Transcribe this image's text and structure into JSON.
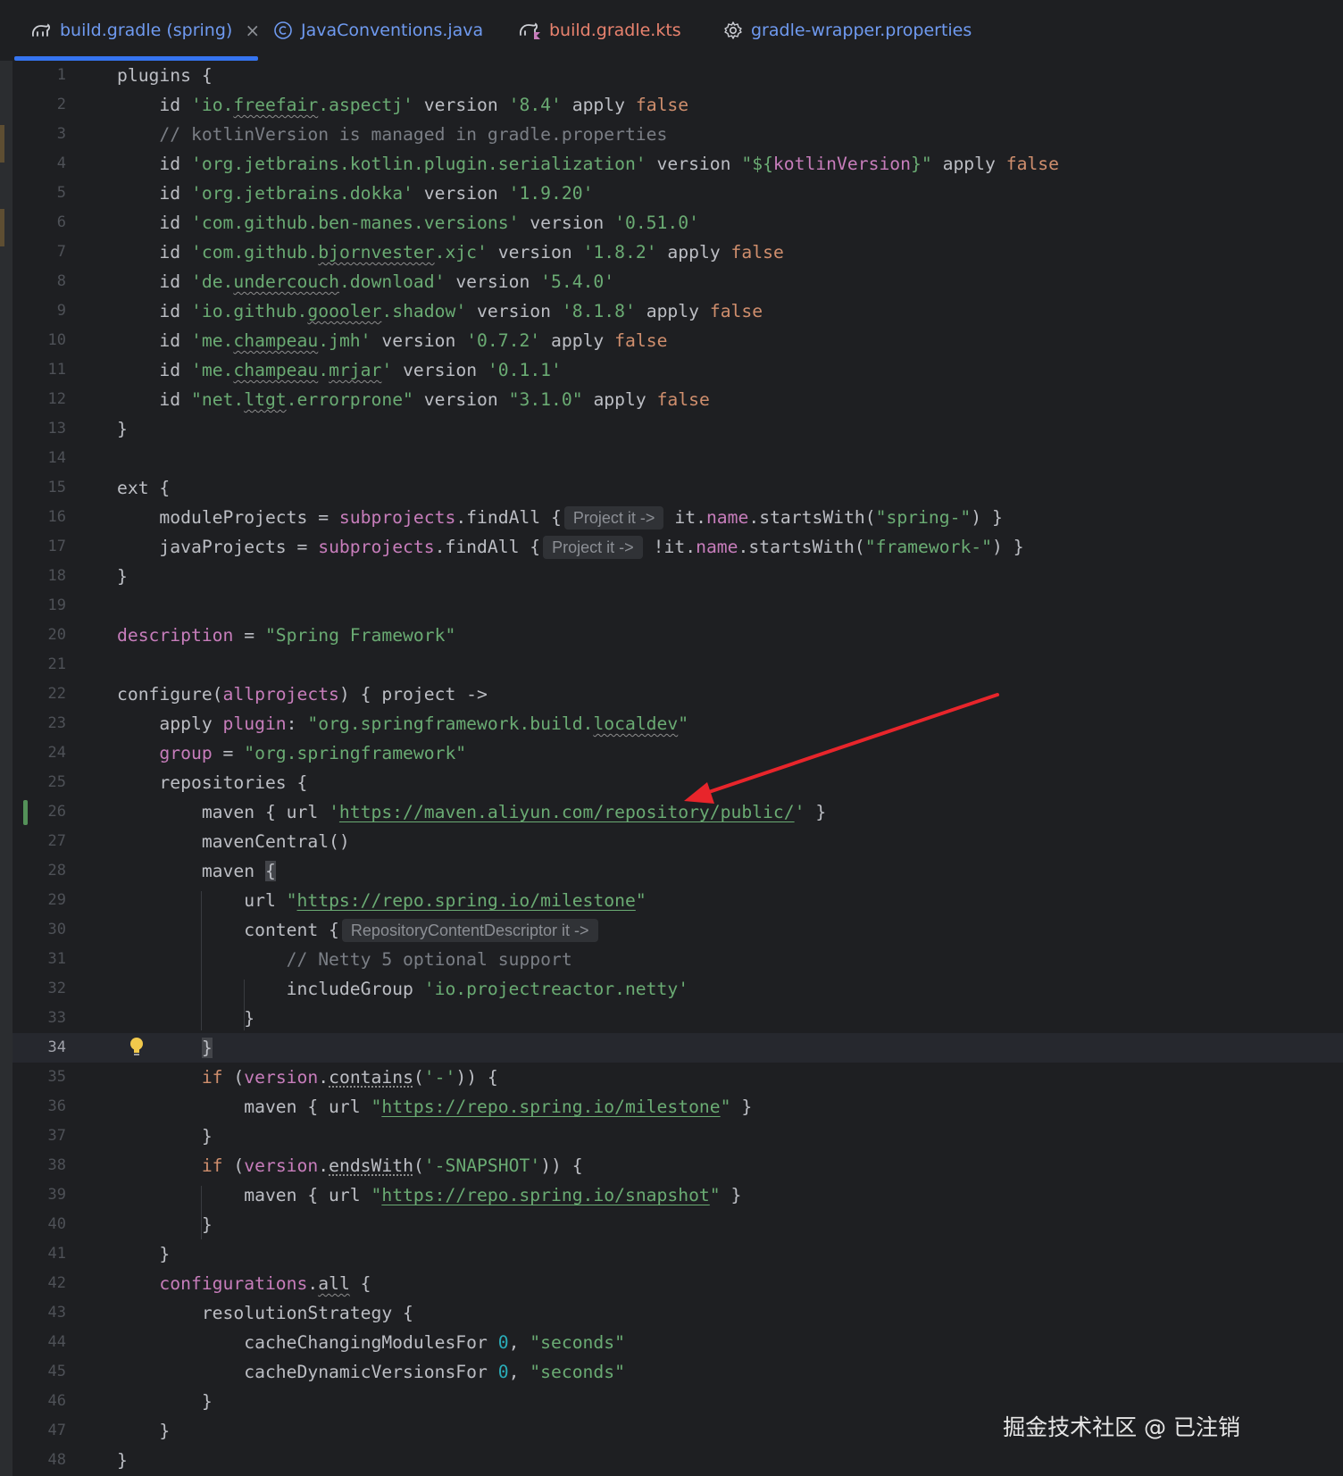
{
  "tabs": [
    {
      "label": "build.gradle (spring)",
      "close": "×",
      "icon": "gradle-elephant-icon",
      "color": "#6f9af0"
    },
    {
      "label": "JavaConventions.java",
      "icon": "java-class-icon",
      "color": "#6f9af0"
    },
    {
      "label": "build.gradle.kts",
      "icon": "gradle-kotlin-icon",
      "color": "#e8826e"
    },
    {
      "label": "gradle-wrapper.properties",
      "icon": "gear-icon",
      "color": "#6f9af0"
    }
  ],
  "editor": {
    "current_line": 34,
    "line_numbers": [
      "1",
      "2",
      "3",
      "4",
      "5",
      "6",
      "7",
      "8",
      "9",
      "10",
      "11",
      "12",
      "13",
      "14",
      "15",
      "16",
      "17",
      "18",
      "19",
      "20",
      "21",
      "22",
      "23",
      "24",
      "25",
      "26",
      "27",
      "28",
      "29",
      "30",
      "31",
      "32",
      "33",
      "34",
      "35",
      "36",
      "37",
      "38",
      "39",
      "40",
      "41",
      "42",
      "43",
      "44",
      "45",
      "46",
      "47",
      "48"
    ],
    "inlay_hints": {
      "h16": "Project it ->",
      "h17": "Project it ->",
      "h30": "RepositoryContentDescriptor it ->"
    },
    "t": {
      "l1a": "plugins {",
      "l2a": "    id ",
      "l2b": "'io.",
      "l2c": "freefair",
      "l2d": ".aspectj'",
      "l2e": " version ",
      "l2f": "'8.4'",
      "l2g": " apply ",
      "l2h": "false",
      "l3a": "    // kotlinVersion is managed in gradle.properties",
      "l4a": "    id ",
      "l4b": "'org.jetbrains.kotlin.plugin.serialization'",
      "l4c": " version ",
      "l4d": "\"${",
      "l4e": "kotlinVersion",
      "l4f": "}\"",
      "l4g": " apply ",
      "l4h": "false",
      "l5a": "    id ",
      "l5b": "'org.jetbrains.dokka'",
      "l5c": " version ",
      "l5d": "'1.9.20'",
      "l6a": "    id ",
      "l6b": "'com.github.ben-manes.versions'",
      "l6c": " version ",
      "l6d": "'0.51.0'",
      "l7a": "    id ",
      "l7b": "'com.github.",
      "l7c": "bjornvester",
      "l7d": ".xjc'",
      "l7e": " version ",
      "l7f": "'1.8.2'",
      "l7g": " apply ",
      "l7h": "false",
      "l8a": "    id ",
      "l8b": "'de.",
      "l8c": "undercouch",
      "l8d": ".download'",
      "l8e": " version ",
      "l8f": "'5.4.0'",
      "l9a": "    id ",
      "l9b": "'io.github.",
      "l9c": "goooler",
      "l9d": ".shadow'",
      "l9e": " version ",
      "l9f": "'8.1.8'",
      "l9g": " apply ",
      "l9h": "false",
      "l10a": "    id ",
      "l10b": "'me.",
      "l10c": "champeau",
      "l10d": ".jmh'",
      "l10e": " version ",
      "l10f": "'0.7.2'",
      "l10g": " apply ",
      "l10h": "false",
      "l11a": "    id ",
      "l11b": "'me.",
      "l11c": "champeau",
      "l11d": ".",
      "l11e": "mrjar",
      "l11f": "'",
      "l11g": " version ",
      "l11h": "'0.1.1'",
      "l12a": "    id ",
      "l12b": "\"net.",
      "l12c": "ltgt",
      "l12d": ".errorprone\"",
      "l12e": " version ",
      "l12f": "\"3.1.0\"",
      "l12g": " apply ",
      "l12h": "false",
      "l13a": "}",
      "l15a": "ext {",
      "l16a": "    moduleProjects = ",
      "l16b": "subprojects",
      "l16c": ".findAll {",
      "l16d": "it.",
      "l16e": "name",
      "l16f": ".startsWith(",
      "l16g": "\"spring-\"",
      "l16h": ") }",
      "l17a": "    javaProjects = ",
      "l17b": "subprojects",
      "l17c": ".findAll {",
      "l17d": "!it.",
      "l17e": "name",
      "l17f": ".startsWith(",
      "l17g": "\"framework-\"",
      "l17h": ") }",
      "l18a": "}",
      "l20a": "description",
      "l20b": " = ",
      "l20c": "\"Spring Framework\"",
      "l22a": "configure(",
      "l22b": "allprojects",
      "l22c": ") { project ->",
      "l23a": "    apply ",
      "l23b": "plugin",
      "l23c": ": ",
      "l23d": "\"org.springframework.build.",
      "l23e": "localdev",
      "l23f": "\"",
      "l24a": "    ",
      "l24b": "group",
      "l24c": " = ",
      "l24d": "\"org.springframework\"",
      "l25a": "    repositories {",
      "l26a": "        maven { url ",
      "l26b": "'",
      "l26c": "https://maven.aliyun.com/repository/public/",
      "l26d": "'",
      "l26e": " }",
      "l27a": "        mavenCentral()",
      "l28a": "        maven ",
      "l28b": "{",
      "l29a": "            url ",
      "l29b": "\"",
      "l29c": "https://repo.spring.io/milestone",
      "l29d": "\"",
      "l30a": "            content {",
      "l31a": "                // Netty 5 optional support",
      "l32a": "                includeGroup ",
      "l32b": "'io.projectreactor.netty'",
      "l33a": "            }",
      "l34a": "        ",
      "l34b": "}",
      "l35a": "        ",
      "l35b": "if",
      "l35c": " (",
      "l35d": "version",
      "l35e": ".",
      "l35f": "contains",
      "l35g": "(",
      "l35h": "'-'",
      "l35i": ")) {",
      "l36a": "            maven { url ",
      "l36b": "\"",
      "l36c": "https://repo.spring.io/milestone",
      "l36d": "\"",
      "l36e": " }",
      "l37a": "        }",
      "l38a": "        ",
      "l38b": "if",
      "l38c": " (",
      "l38d": "version",
      "l38e": ".",
      "l38f": "endsWith",
      "l38g": "(",
      "l38h": "'-SNAPSHOT'",
      "l38i": ")) {",
      "l39a": "            maven { url ",
      "l39b": "\"",
      "l39c": "https://repo.spring.io/snapshot",
      "l39d": "\"",
      "l39e": " }",
      "l40a": "        }",
      "l41a": "    }",
      "l42a": "    ",
      "l42b": "configurations",
      "l42c": ".",
      "l42d": "all",
      "l42e": " {",
      "l43a": "        resolutionStrategy {",
      "l44a": "            cacheChangingModulesFor ",
      "l44b": "0",
      "l44c": ", ",
      "l44d": "\"seconds\"",
      "l45a": "            cacheDynamicVersionsFor ",
      "l45b": "0",
      "l45c": ", ",
      "l45d": "\"seconds\"",
      "l46a": "        }",
      "l47a": "    }",
      "l48a": "}"
    }
  },
  "watermark": "掘金技术社区 @ 已注销",
  "colors": {
    "background": "#1e1f22",
    "keyword": "#cf8e6d",
    "string": "#6aab73",
    "number": "#2aacb8",
    "comment": "#7a7e85",
    "property": "#c77dbb",
    "tab_active_underline": "#3574f0",
    "vcs_change_bar": "#549159",
    "annotation_arrow": "#e8252b"
  }
}
